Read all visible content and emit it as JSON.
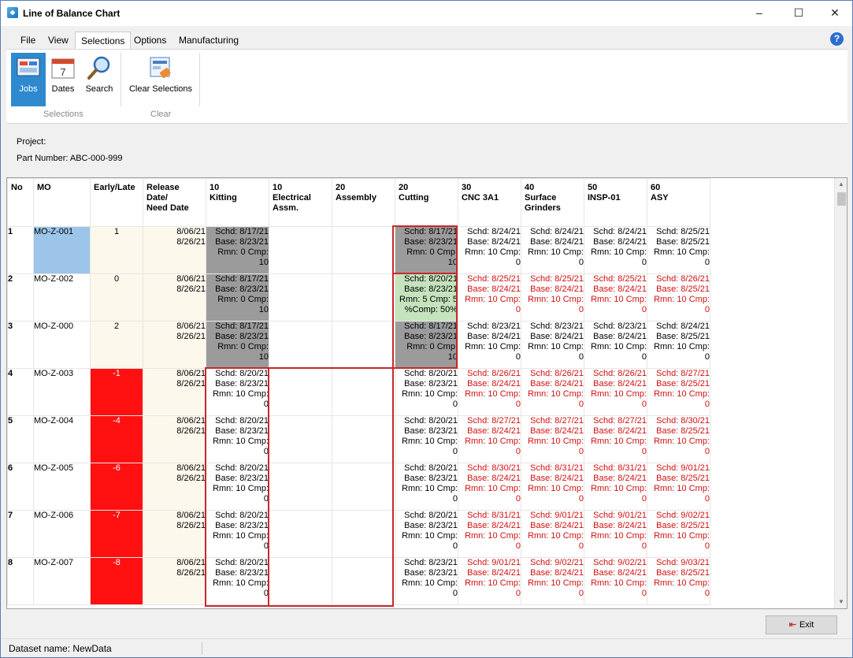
{
  "window": {
    "title": "Line of Balance Chart",
    "minimize": "–",
    "maximize": "☐",
    "close": "✕"
  },
  "menu": [
    "File",
    "View",
    "Selections",
    "Options",
    "Manufacturing"
  ],
  "help_icon": "?",
  "ribbon": {
    "buttons": [
      {
        "label": "Jobs",
        "icon": "jobs-icon",
        "active": true
      },
      {
        "label": "Dates",
        "icon": "calendar-icon"
      },
      {
        "label": "Search",
        "icon": "search-icon"
      },
      {
        "label": "Clear Selections",
        "icon": "clear-selections-icon"
      }
    ],
    "groups": [
      "Selections",
      "Clear"
    ]
  },
  "info": {
    "project_label": "Project:",
    "part_number_label": "Part Number:  ABC-000-999"
  },
  "colors": {
    "late": "#ff1010",
    "complete": "#9b9b9b",
    "in_progress": "#c5e3bd",
    "selected": "#9cc5e9",
    "overdue_text": "#d01010"
  },
  "grid": {
    "headers": [
      "No",
      "MO",
      "Early/Late",
      "Release\nDate/\nNeed Date",
      "10\nKitting",
      "10\nElectrical\nAssm.",
      "20\nAssembly",
      "20\nCutting",
      "30\nCNC 3A1",
      "40\nSurface\nGrinders",
      "50\nINSP-01",
      "60\nASY"
    ],
    "rows": [
      {
        "no": "1",
        "mo": "MO-Z-001",
        "el": "1",
        "rel": "8/06/21\n8/26/21",
        "cells": [
          {
            "t": "Schd: 8/17/21\nBase: 8/23/21\nRmn: 0 Cmp:\n10",
            "s": "gray"
          },
          {
            "t": "",
            "s": ""
          },
          {
            "t": "",
            "s": ""
          },
          {
            "t": "Schd: 8/17/21\nBase: 8/23/21\nRmn: 0 Cmp:\n10",
            "s": "gray"
          },
          {
            "t": "Schd: 8/24/21\nBase: 8/24/21\nRmn: 10 Cmp:\n0",
            "s": ""
          },
          {
            "t": "Schd: 8/24/21\nBase: 8/24/21\nRmn: 10 Cmp:\n0",
            "s": ""
          },
          {
            "t": "Schd: 8/24/21\nBase: 8/24/21\nRmn: 10 Cmp:\n0",
            "s": ""
          },
          {
            "t": "Schd: 8/25/21\nBase: 8/25/21\nRmn: 10 Cmp:\n0",
            "s": ""
          }
        ]
      },
      {
        "no": "2",
        "mo": "MO-Z-002",
        "el": "0",
        "rel": "8/06/21\n8/26/21",
        "cells": [
          {
            "t": "Schd: 8/17/21\nBase: 8/23/21\nRmn: 0 Cmp:\n10",
            "s": "gray"
          },
          {
            "t": "",
            "s": ""
          },
          {
            "t": "",
            "s": ""
          },
          {
            "t": "Schd: 8/20/21\nBase: 8/23/21\nRmn: 5 Cmp: 5\n%Comp: 50%",
            "s": "green"
          },
          {
            "t": "Schd: 8/25/21\nBase: 8/24/21\nRmn: 10 Cmp:\n0",
            "s": "red"
          },
          {
            "t": "Schd: 8/25/21\nBase: 8/24/21\nRmn: 10 Cmp:\n0",
            "s": "red"
          },
          {
            "t": "Schd: 8/25/21\nBase: 8/24/21\nRmn: 10 Cmp:\n0",
            "s": "red"
          },
          {
            "t": "Schd: 8/26/21\nBase: 8/25/21\nRmn: 10 Cmp:\n0",
            "s": "red"
          }
        ]
      },
      {
        "no": "3",
        "mo": "MO-Z-000",
        "el": "2",
        "rel": "8/06/21\n8/26/21",
        "cells": [
          {
            "t": "Schd: 8/17/21\nBase: 8/23/21\nRmn: 0 Cmp:\n10",
            "s": "gray"
          },
          {
            "t": "",
            "s": ""
          },
          {
            "t": "",
            "s": ""
          },
          {
            "t": "Schd: 8/17/21\nBase: 8/23/21\nRmn: 0 Cmp:\n10",
            "s": "gray"
          },
          {
            "t": "Schd: 8/23/21\nBase: 8/24/21\nRmn: 10 Cmp:\n0",
            "s": ""
          },
          {
            "t": "Schd: 8/23/21\nBase: 8/24/21\nRmn: 10 Cmp:\n0",
            "s": ""
          },
          {
            "t": "Schd: 8/23/21\nBase: 8/24/21\nRmn: 10 Cmp:\n0",
            "s": ""
          },
          {
            "t": "Schd: 8/24/21\nBase: 8/25/21\nRmn: 10 Cmp:\n0",
            "s": ""
          }
        ]
      },
      {
        "no": "4",
        "mo": "MO-Z-003",
        "el": "-1",
        "rel": "8/06/21\n8/26/21",
        "cells": [
          {
            "t": "Schd: 8/20/21\nBase: 8/23/21\nRmn: 10 Cmp:\n0",
            "s": ""
          },
          {
            "t": "",
            "s": ""
          },
          {
            "t": "",
            "s": ""
          },
          {
            "t": "Schd: 8/20/21\nBase: 8/23/21\nRmn: 10 Cmp:\n0",
            "s": ""
          },
          {
            "t": "Schd: 8/26/21\nBase: 8/24/21\nRmn: 10 Cmp:\n0",
            "s": "red"
          },
          {
            "t": "Schd: 8/26/21\nBase: 8/24/21\nRmn: 10 Cmp:\n0",
            "s": "red"
          },
          {
            "t": "Schd: 8/26/21\nBase: 8/24/21\nRmn: 10 Cmp:\n0",
            "s": "red"
          },
          {
            "t": "Schd: 8/27/21\nBase: 8/25/21\nRmn: 10 Cmp:\n0",
            "s": "red"
          }
        ]
      },
      {
        "no": "5",
        "mo": "MO-Z-004",
        "el": "-4",
        "rel": "8/06/21\n8/26/21",
        "cells": [
          {
            "t": "Schd: 8/20/21\nBase: 8/23/21\nRmn: 10 Cmp:\n0",
            "s": ""
          },
          {
            "t": "",
            "s": ""
          },
          {
            "t": "",
            "s": ""
          },
          {
            "t": "Schd: 8/20/21\nBase: 8/23/21\nRmn: 10 Cmp:\n0",
            "s": ""
          },
          {
            "t": "Schd: 8/27/21\nBase: 8/24/21\nRmn: 10 Cmp:\n0",
            "s": "red"
          },
          {
            "t": "Schd: 8/27/21\nBase: 8/24/21\nRmn: 10 Cmp:\n0",
            "s": "red"
          },
          {
            "t": "Schd: 8/27/21\nBase: 8/24/21\nRmn: 10 Cmp:\n0",
            "s": "red"
          },
          {
            "t": "Schd: 8/30/21\nBase: 8/25/21\nRmn: 10 Cmp:\n0",
            "s": "red"
          }
        ]
      },
      {
        "no": "6",
        "mo": "MO-Z-005",
        "el": "-6",
        "rel": "8/06/21\n8/26/21",
        "cells": [
          {
            "t": "Schd: 8/20/21\nBase: 8/23/21\nRmn: 10 Cmp:\n0",
            "s": ""
          },
          {
            "t": "",
            "s": ""
          },
          {
            "t": "",
            "s": ""
          },
          {
            "t": "Schd: 8/20/21\nBase: 8/23/21\nRmn: 10 Cmp:\n0",
            "s": ""
          },
          {
            "t": "Schd: 8/30/21\nBase: 8/24/21\nRmn: 10 Cmp:\n0",
            "s": "red"
          },
          {
            "t": "Schd: 8/31/21\nBase: 8/24/21\nRmn: 10 Cmp:\n0",
            "s": "red"
          },
          {
            "t": "Schd: 8/31/21\nBase: 8/24/21\nRmn: 10 Cmp:\n0",
            "s": "red"
          },
          {
            "t": "Schd: 9/01/21\nBase: 8/25/21\nRmn: 10 Cmp:\n0",
            "s": "red"
          }
        ]
      },
      {
        "no": "7",
        "mo": "MO-Z-006",
        "el": "-7",
        "rel": "8/06/21\n8/26/21",
        "cells": [
          {
            "t": "Schd: 8/20/21\nBase: 8/23/21\nRmn: 10 Cmp:\n0",
            "s": ""
          },
          {
            "t": "",
            "s": ""
          },
          {
            "t": "",
            "s": ""
          },
          {
            "t": "Schd: 8/20/21\nBase: 8/23/21\nRmn: 10 Cmp:\n0",
            "s": ""
          },
          {
            "t": "Schd: 8/31/21\nBase: 8/24/21\nRmn: 10 Cmp:\n0",
            "s": "red"
          },
          {
            "t": "Schd: 9/01/21\nBase: 8/24/21\nRmn: 10 Cmp:\n0",
            "s": "red"
          },
          {
            "t": "Schd: 9/01/21\nBase: 8/24/21\nRmn: 10 Cmp:\n0",
            "s": "red"
          },
          {
            "t": "Schd: 9/02/21\nBase: 8/25/21\nRmn: 10 Cmp:\n0",
            "s": "red"
          }
        ]
      },
      {
        "no": "8",
        "mo": "MO-Z-007",
        "el": "-8",
        "rel": "8/06/21\n8/26/21",
        "cells": [
          {
            "t": "Schd: 8/20/21\nBase: 8/23/21\nRmn: 10 Cmp:\n0",
            "s": ""
          },
          {
            "t": "",
            "s": ""
          },
          {
            "t": "",
            "s": ""
          },
          {
            "t": "Schd: 8/23/21\nBase: 8/23/21\nRmn: 10 Cmp:\n0",
            "s": ""
          },
          {
            "t": "Schd: 9/01/21\nBase: 8/24/21\nRmn: 10 Cmp:\n0",
            "s": "red"
          },
          {
            "t": "Schd: 9/02/21\nBase: 8/24/21\nRmn: 10 Cmp:\n0",
            "s": "red"
          },
          {
            "t": "Schd: 9/02/21\nBase: 8/24/21\nRmn: 10 Cmp:\n0",
            "s": "red"
          },
          {
            "t": "Schd: 9/03/21\nBase: 8/25/21\nRmn: 10 Cmp:\n0",
            "s": "red"
          }
        ]
      }
    ]
  },
  "footer": {
    "exit_label": "Exit"
  },
  "status": {
    "dataset": "Dataset name:  NewData"
  }
}
